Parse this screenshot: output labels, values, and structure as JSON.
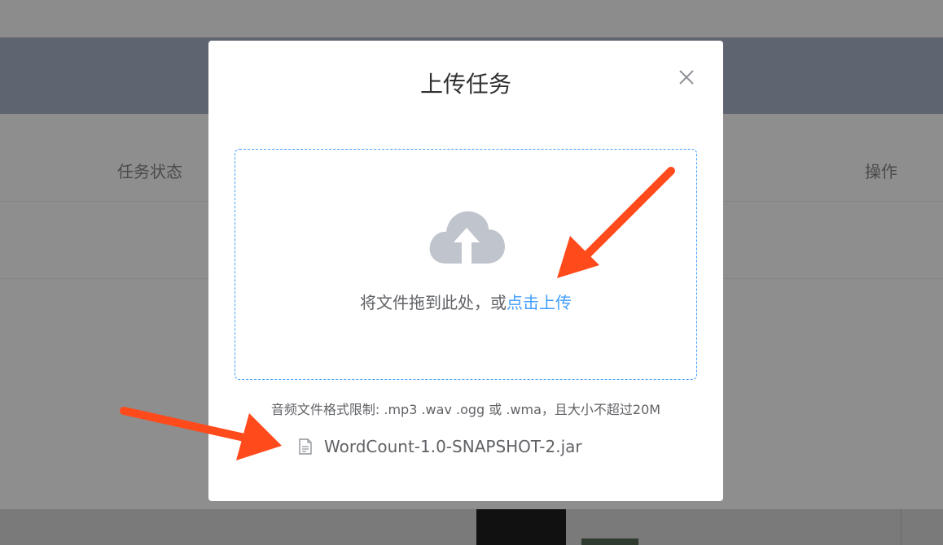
{
  "background": {
    "columns": {
      "status": "任务状态",
      "action": "操作"
    }
  },
  "dialog": {
    "title": "上传任务",
    "upload": {
      "drag_text": "将文件拖到此处，或",
      "click_text": "点击上传"
    },
    "tip": "音频文件格式限制: .mp3 .wav .ogg 或 .wma，且大小不超过20M",
    "files": [
      {
        "name": "WordCount-1.0-SNAPSHOT-2.jar"
      }
    ]
  },
  "colors": {
    "accent": "#409eff",
    "annotation": "#ff4a1c"
  }
}
